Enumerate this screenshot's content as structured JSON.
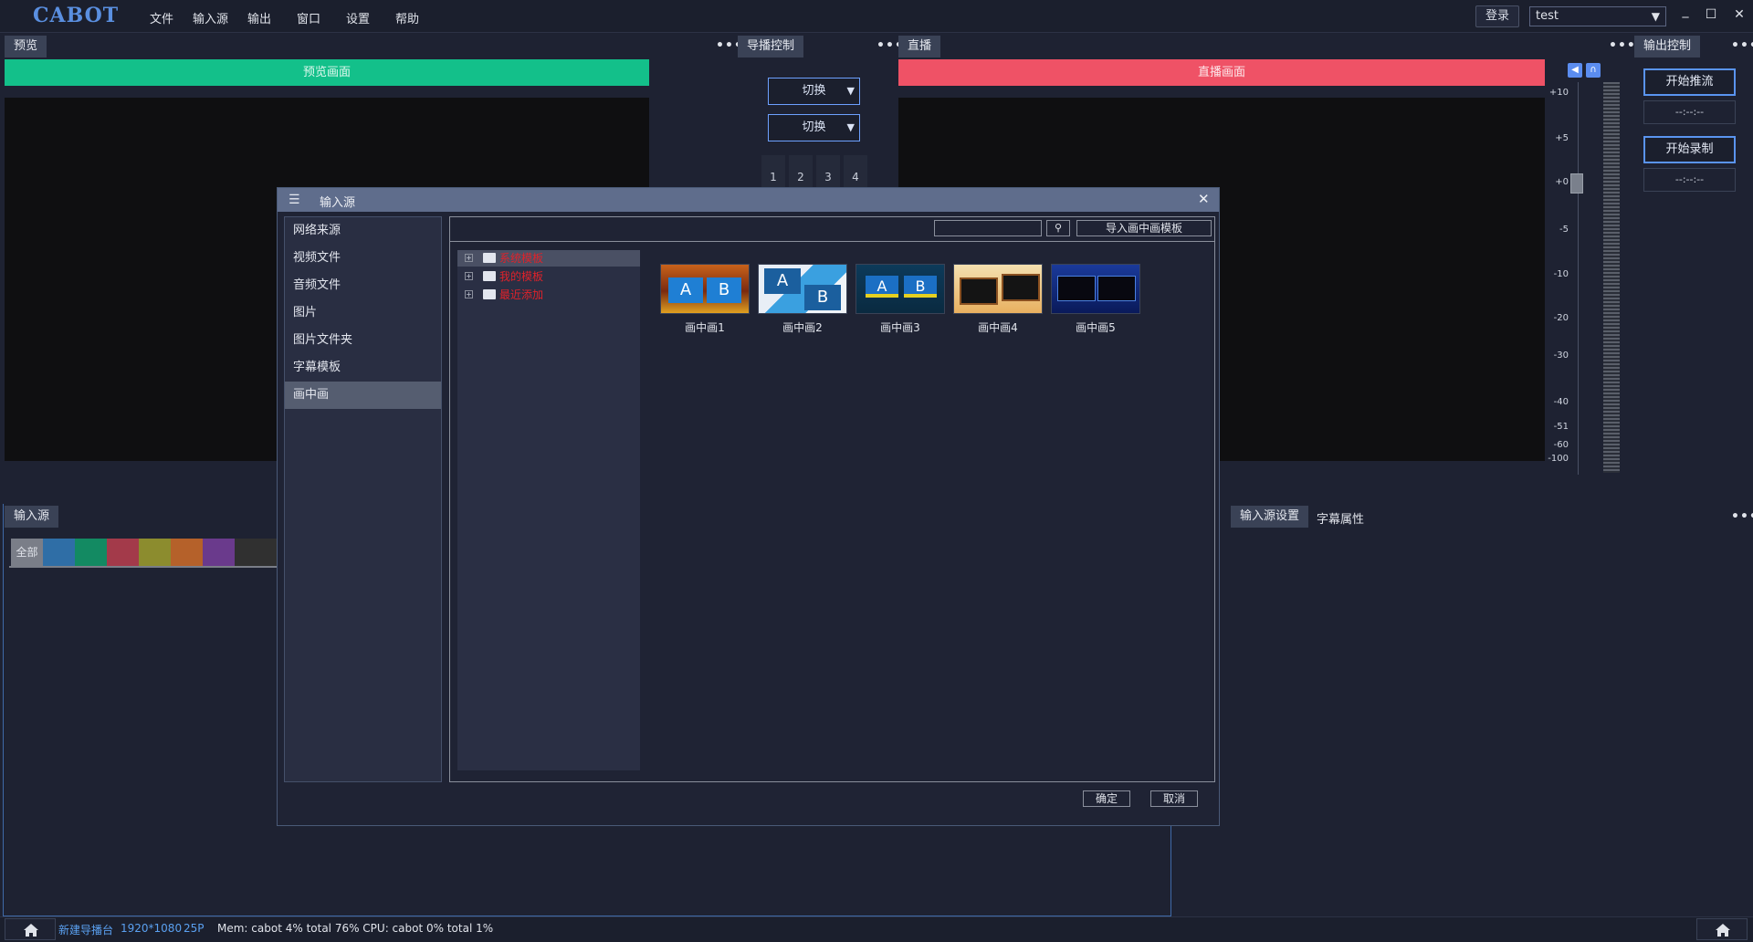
{
  "app": {
    "logo": "CABOT"
  },
  "menu": [
    "文件",
    "输入源",
    "输出",
    "窗口",
    "设置",
    "帮助"
  ],
  "topbar": {
    "login": "登录",
    "user": "test",
    "minimize": "_",
    "maximize": "☐",
    "close": "✕"
  },
  "preview": {
    "tab": "预览",
    "bar": "预览画面"
  },
  "director": {
    "tab": "导播控制",
    "switch1": "切换",
    "switch2": "切换",
    "numbers": [
      "1",
      "2",
      "3",
      "4"
    ]
  },
  "live": {
    "tab": "直播",
    "bar": "直播画面"
  },
  "meter": {
    "labels": [
      "+10",
      "+5",
      "+0",
      "-5",
      "-10",
      "-20",
      "-30",
      "-40",
      "-51",
      "-60",
      "-100"
    ]
  },
  "output": {
    "tab": "输出控制",
    "stream_btn": "开始推流",
    "stream_time": "--:--:--",
    "record_btn": "开始录制",
    "record_time": "--:--:--"
  },
  "source_panel": {
    "tab": "输入源",
    "all": "全部",
    "colors": [
      "#2f6ea6",
      "#138a62",
      "#a33a4a",
      "#8c8c2e",
      "#b5612a",
      "#6a3a8c",
      "#303030"
    ]
  },
  "right_panel": {
    "tab1": "输入源设置",
    "tab2": "字幕属性"
  },
  "status": {
    "name": "新建导播台",
    "resolution": "1920*1080",
    "fps": "25P",
    "stats": "Mem: cabot 4% total 76% CPU: cabot 0% total 1%"
  },
  "dialog": {
    "title": "输入源",
    "categories": [
      "网络来源",
      "视频文件",
      "音频文件",
      "图片",
      "图片文件夹",
      "字幕模板",
      "画中画"
    ],
    "active_category": 6,
    "search_placeholder": "",
    "import_btn": "导入画中画模板",
    "tree": [
      "系统模板",
      "我的模板",
      "最近添加"
    ],
    "templates": [
      "画中画1",
      "画中画2",
      "画中画3",
      "画中画4",
      "画中画5"
    ],
    "ok": "确定",
    "cancel": "取消"
  }
}
